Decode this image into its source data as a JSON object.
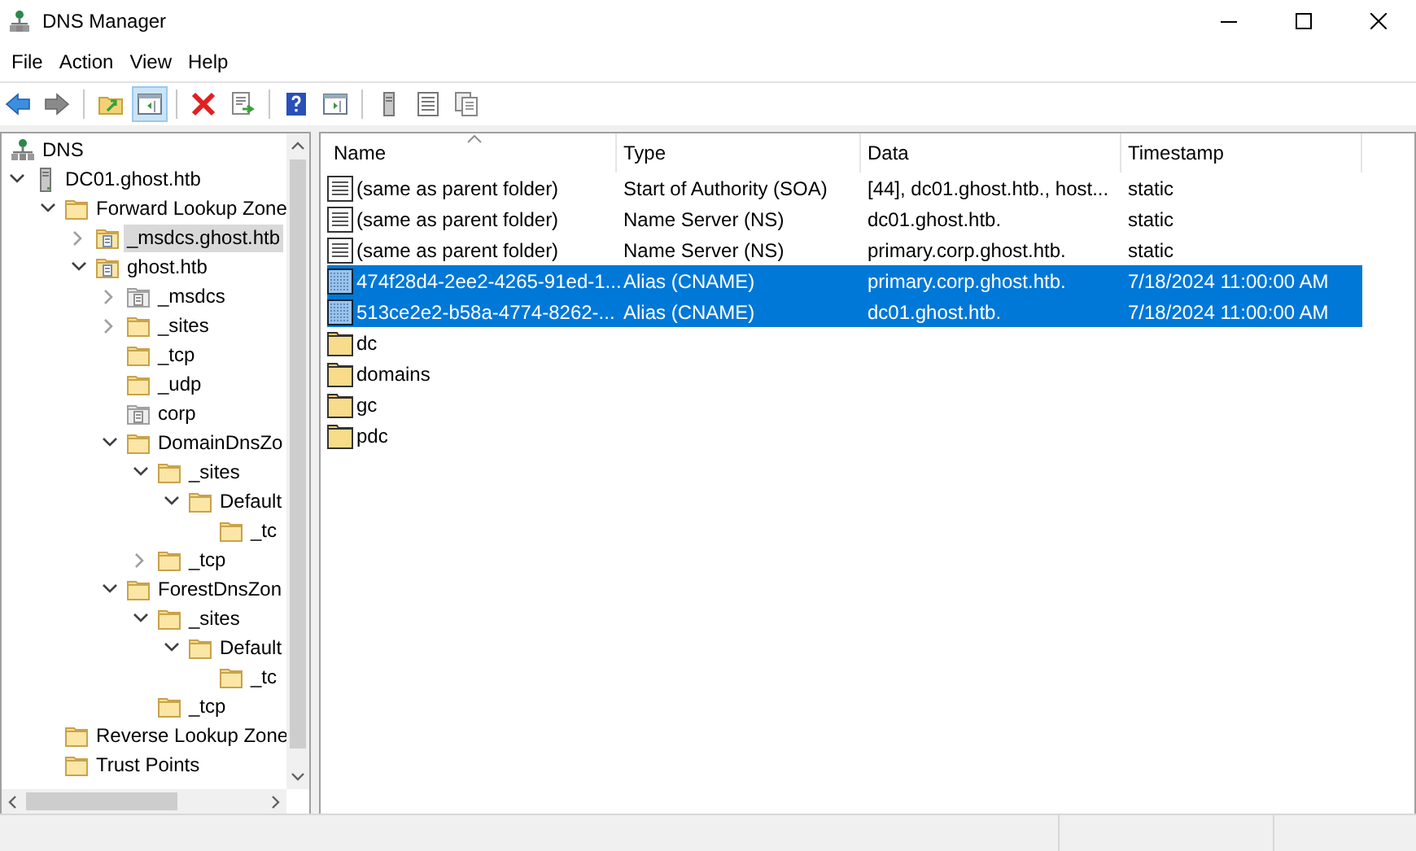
{
  "window": {
    "title": "DNS Manager"
  },
  "menu": [
    {
      "label": "File"
    },
    {
      "label": "Action"
    },
    {
      "label": "View"
    },
    {
      "label": "Help"
    }
  ],
  "toolbar": [
    {
      "kind": "back",
      "pressed": false
    },
    {
      "kind": "forward",
      "pressed": false
    },
    {
      "kind": "sep"
    },
    {
      "kind": "up",
      "pressed": false
    },
    {
      "kind": "tree",
      "pressed": true
    },
    {
      "kind": "sep"
    },
    {
      "kind": "delete",
      "pressed": false
    },
    {
      "kind": "export",
      "pressed": false
    },
    {
      "kind": "sep"
    },
    {
      "kind": "help",
      "pressed": false
    },
    {
      "kind": "panel",
      "pressed": false
    },
    {
      "kind": "sep"
    },
    {
      "kind": "server",
      "pressed": false
    },
    {
      "kind": "list",
      "pressed": false
    },
    {
      "kind": "copy",
      "pressed": false
    }
  ],
  "tree": {
    "kind": "dns-root",
    "label": "DNS",
    "selected": false,
    "children": [
      {
        "kind": "server",
        "label": "DC01.ghost.htb",
        "selected": false,
        "expanded": true,
        "children": [
          {
            "kind": "folder",
            "label": "Forward Lookup Zone",
            "selected": false,
            "expanded": true,
            "children": [
              {
                "kind": "zone",
                "label": "_msdcs.ghost.htb",
                "selected": true,
                "expanded": false
              },
              {
                "kind": "zone",
                "label": "ghost.htb",
                "selected": false,
                "expanded": true,
                "children": [
                  {
                    "kind": "delegation",
                    "label": "_msdcs",
                    "selected": false,
                    "expanded": false
                  },
                  {
                    "kind": "folder",
                    "label": "_sites",
                    "selected": false,
                    "expanded": false
                  },
                  {
                    "kind": "folder",
                    "label": "_tcp",
                    "selected": false
                  },
                  {
                    "kind": "folder",
                    "label": "_udp",
                    "selected": false
                  },
                  {
                    "kind": "delegation",
                    "label": "corp",
                    "selected": false
                  },
                  {
                    "kind": "folder",
                    "label": "DomainDnsZo",
                    "selected": false,
                    "expanded": true,
                    "children": [
                      {
                        "kind": "folder",
                        "label": "_sites",
                        "selected": false,
                        "expanded": true,
                        "children": [
                          {
                            "kind": "folder",
                            "label": "Default",
                            "selected": false,
                            "expanded": true,
                            "children": [
                              {
                                "kind": "folder",
                                "label": "_tc",
                                "selected": false
                              }
                            ]
                          }
                        ]
                      },
                      {
                        "kind": "folder",
                        "label": "_tcp",
                        "selected": false,
                        "expanded": false
                      }
                    ]
                  },
                  {
                    "kind": "folder",
                    "label": "ForestDnsZon",
                    "selected": false,
                    "expanded": true,
                    "children": [
                      {
                        "kind": "folder",
                        "label": "_sites",
                        "selected": false,
                        "expanded": true,
                        "children": [
                          {
                            "kind": "folder",
                            "label": "Default",
                            "selected": false,
                            "expanded": true,
                            "children": [
                              {
                                "kind": "folder",
                                "label": "_tc",
                                "selected": false
                              }
                            ]
                          }
                        ]
                      },
                      {
                        "kind": "folder",
                        "label": "_tcp",
                        "selected": false
                      }
                    ]
                  }
                ]
              }
            ]
          },
          {
            "kind": "folder",
            "label": "Reverse Lookup Zone",
            "selected": false
          },
          {
            "kind": "folder",
            "label": "Trust Points",
            "selected": false
          }
        ]
      }
    ]
  },
  "list": {
    "columns": [
      {
        "label": "Name",
        "sorted": true
      },
      {
        "label": "Type",
        "sorted": false
      },
      {
        "label": "Data",
        "sorted": false
      },
      {
        "label": "Timestamp",
        "sorted": false
      }
    ],
    "rows": [
      {
        "kind": "record",
        "selected": false,
        "name": "(same as parent folder)",
        "type": "Start of Authority (SOA)",
        "data": "[44], dc01.ghost.htb., host...",
        "timestamp": "static"
      },
      {
        "kind": "record",
        "selected": false,
        "name": "(same as parent folder)",
        "type": "Name Server (NS)",
        "data": "dc01.ghost.htb.",
        "timestamp": "static"
      },
      {
        "kind": "record",
        "selected": false,
        "name": "(same as parent folder)",
        "type": "Name Server (NS)",
        "data": "primary.corp.ghost.htb.",
        "timestamp": "static"
      },
      {
        "kind": "record",
        "selected": true,
        "name": "474f28d4-2ee2-4265-91ed-1...",
        "type": "Alias (CNAME)",
        "data": "primary.corp.ghost.htb.",
        "timestamp": "7/18/2024 11:00:00 AM"
      },
      {
        "kind": "record",
        "selected": true,
        "name": "513ce2e2-b58a-4774-8262-...",
        "type": "Alias (CNAME)",
        "data": "dc01.ghost.htb.",
        "timestamp": "7/18/2024 11:00:00 AM"
      },
      {
        "kind": "folder",
        "selected": false,
        "name": "dc"
      },
      {
        "kind": "folder",
        "selected": false,
        "name": "domains"
      },
      {
        "kind": "folder",
        "selected": false,
        "name": "gc"
      },
      {
        "kind": "folder",
        "selected": false,
        "name": "pdc"
      }
    ]
  }
}
